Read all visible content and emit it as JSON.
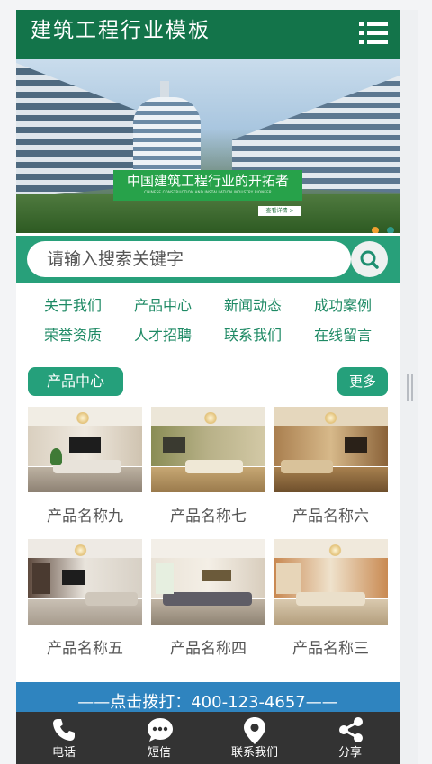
{
  "header": {
    "title": "建筑工程行业模板",
    "menu_icon": "hamburger-menu-icon"
  },
  "banner": {
    "slogan": "中国建筑工程行业的开拓者",
    "slogan_sub": "CHINESE CONSTRUCTION AND INSTALLATION INDUSTRY PIONEER",
    "button_label": "查看详情 >",
    "pager": {
      "count": 2,
      "active_index": 0,
      "active_color": "#f0a030",
      "inactive_color": "#2e9a8a"
    }
  },
  "search": {
    "placeholder": "请输入搜索关键字",
    "button_icon": "search-icon"
  },
  "nav": {
    "items": [
      "关于我们",
      "产品中心",
      "新闻动态",
      "成功案例",
      "荣誉资质",
      "人才招聘",
      "联系我们",
      "在线留言"
    ]
  },
  "products": {
    "title": "产品中心",
    "more_label": "更多",
    "items": [
      {
        "name": "产品名称九"
      },
      {
        "name": "产品名称七"
      },
      {
        "name": "产品名称六"
      },
      {
        "name": "产品名称五"
      },
      {
        "name": "产品名称四"
      },
      {
        "name": "产品名称三"
      }
    ]
  },
  "call": {
    "text": "——点击拨打：400-123-4657——"
  },
  "tabbar": {
    "items": [
      {
        "label": "电话",
        "icon": "phone-icon"
      },
      {
        "label": "短信",
        "icon": "message-icon"
      },
      {
        "label": "联系我们",
        "icon": "location-pin-icon"
      },
      {
        "label": "分享",
        "icon": "share-icon"
      }
    ]
  },
  "colors": {
    "header_bg": "#13744a",
    "accent_green": "#25a07b",
    "call_bar": "#2f84bf",
    "tabbar_bg": "#333333"
  }
}
